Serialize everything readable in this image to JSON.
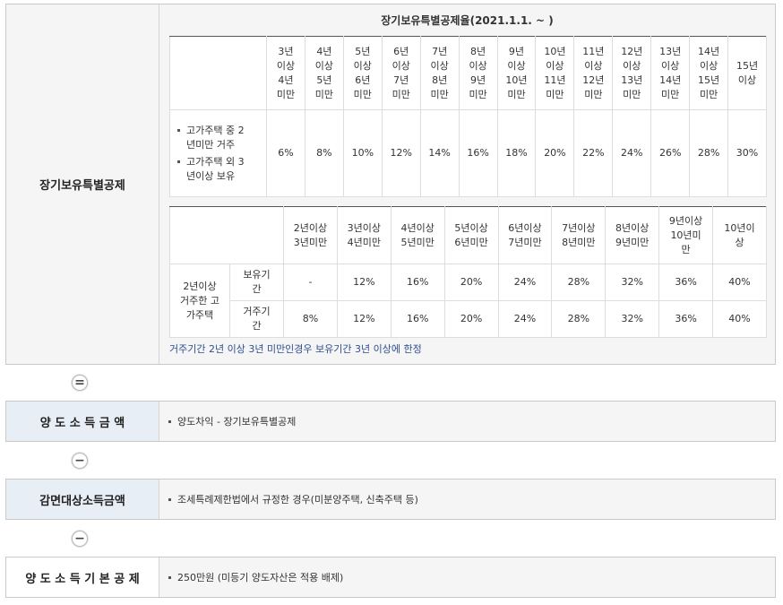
{
  "deduction": {
    "label": "장기보유특별공제",
    "rate_title": "장기보유특별공제율(2021.1.1. ~ )",
    "table1": {
      "headers": [
        [
          "3년",
          "이상",
          "4년",
          "미만"
        ],
        [
          "4년",
          "이상",
          "5년",
          "미만"
        ],
        [
          "5년",
          "이상",
          "6년",
          "미만"
        ],
        [
          "6년",
          "이상",
          "7년",
          "미만"
        ],
        [
          "7년",
          "이상",
          "8년",
          "미만"
        ],
        [
          "8년",
          "이상",
          "9년",
          "미만"
        ],
        [
          "9년",
          "이상",
          "10년",
          "미만"
        ],
        [
          "10년",
          "이상",
          "11년",
          "미만"
        ],
        [
          "11년",
          "이상",
          "12년",
          "미만"
        ],
        [
          "12년",
          "이상",
          "13년",
          "미만"
        ],
        [
          "13년",
          "이상",
          "14년",
          "미만"
        ],
        [
          "14년",
          "이상",
          "15년",
          "미만"
        ],
        [
          "15년",
          "이상"
        ]
      ],
      "items": [
        [
          "고가주택 중 2",
          "년미만 거주"
        ],
        [
          "고가주택 외 3",
          "년이상 보유"
        ]
      ],
      "values": [
        "6%",
        "8%",
        "10%",
        "12%",
        "14%",
        "16%",
        "18%",
        "20%",
        "22%",
        "24%",
        "26%",
        "28%",
        "30%"
      ]
    },
    "table2": {
      "headers": [
        [
          "2년이상",
          "3년미만"
        ],
        [
          "3년이상",
          "4년미만"
        ],
        [
          "4년이상",
          "5년미만"
        ],
        [
          "5년이상",
          "6년미만"
        ],
        [
          "6년이상",
          "7년미만"
        ],
        [
          "7년이상",
          "8년미만"
        ],
        [
          "8년이상",
          "9년미만"
        ],
        [
          "9년이상",
          "10년미",
          "만"
        ],
        [
          "10년이",
          "상"
        ]
      ],
      "group_label": [
        "2년이상",
        "거주한 고",
        "가주택"
      ],
      "rows": [
        {
          "label": [
            "보유기",
            "간"
          ],
          "values": [
            "-",
            "12%",
            "16%",
            "20%",
            "24%",
            "28%",
            "32%",
            "36%",
            "40%"
          ]
        },
        {
          "label": [
            "거주기",
            "간"
          ],
          "values": [
            "8%",
            "12%",
            "16%",
            "20%",
            "24%",
            "28%",
            "32%",
            "36%",
            "40%"
          ]
        }
      ]
    },
    "note": "거주기간 2년 이상 3년 미만인경우 보유기간 3년 이상에 한정"
  },
  "operators": {
    "equals": "=",
    "minus": "−"
  },
  "transfer_income": {
    "label": "양 도 소 득 금 액",
    "text": "양도차익 - 장기보유특별공제"
  },
  "tax_reduction_income": {
    "label": "감면대상소득금액",
    "text": "조세특례제한법에서 규정한 경우(미분양주택, 신축주택 등)"
  },
  "basic_deduction": {
    "label": "양 도 소 득 기 본 공 제",
    "text": "250만원 (미등기 양도자산은 적용 배제)"
  }
}
